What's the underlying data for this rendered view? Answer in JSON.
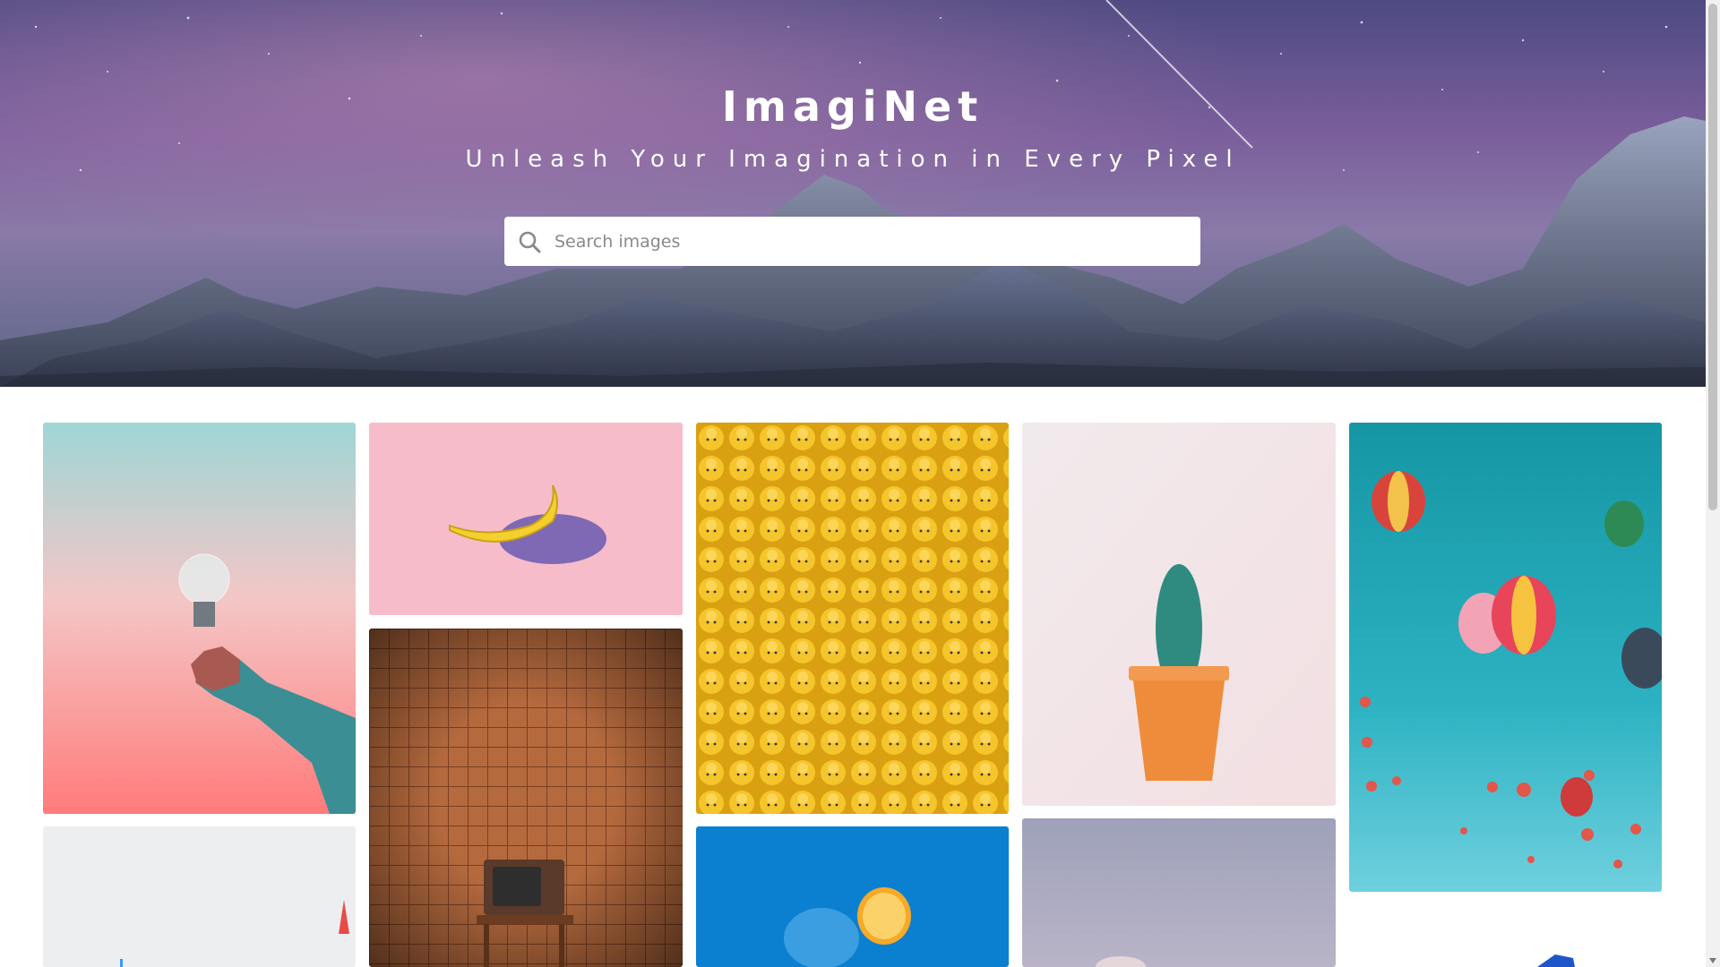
{
  "app": {
    "title": "ImagiNet",
    "subtitle": "Unleash Your Imagination in Every Pixel"
  },
  "search": {
    "placeholder": "Search images",
    "value": "",
    "icon": "search-icon"
  },
  "gallery": {
    "images": [
      {
        "subject": "lightbulb-in-hand"
      },
      {
        "subject": "banana"
      },
      {
        "subject": "lego-heads"
      },
      {
        "subject": "cactus-pot"
      },
      {
        "subject": "hot-air-balloons"
      },
      {
        "subject": "pencils"
      },
      {
        "subject": "retro-tv"
      },
      {
        "subject": "blue-orange"
      },
      {
        "subject": "soft-purple"
      },
      {
        "subject": "blue-object"
      }
    ]
  },
  "colors": {
    "hero_sky": "#6d5a95",
    "search_bg": "#ffffff",
    "page_bg": "#ffffff"
  }
}
